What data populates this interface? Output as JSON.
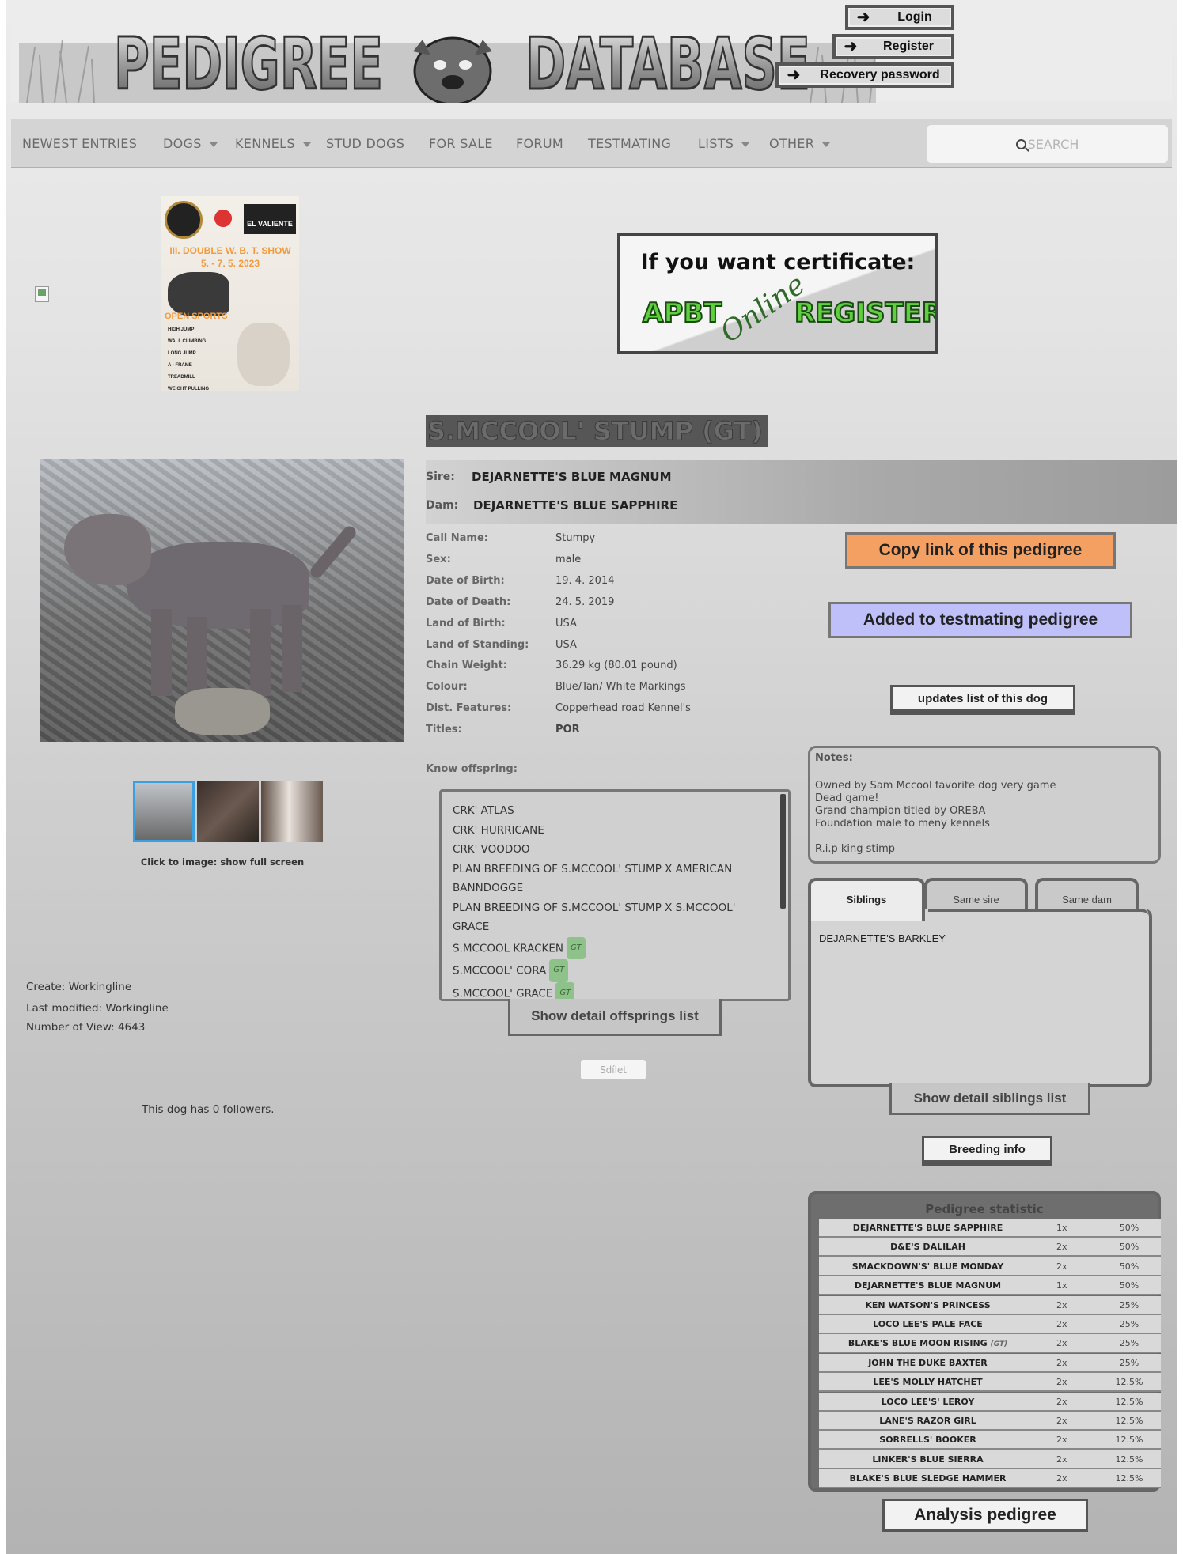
{
  "header": {
    "logo_text": "PEDIGREE DATABASE",
    "auth": {
      "login": "Login",
      "register": "Register",
      "recovery": "Recovery password"
    }
  },
  "nav": {
    "items": [
      {
        "label": "NEWEST ENTRIES",
        "dropdown": false
      },
      {
        "label": "DOGS",
        "dropdown": true
      },
      {
        "label": "KENNELS",
        "dropdown": true
      },
      {
        "label": "STUD DOGS",
        "dropdown": false
      },
      {
        "label": "FOR SALE",
        "dropdown": false
      },
      {
        "label": "FORUM",
        "dropdown": false
      },
      {
        "label": "TESTMATING",
        "dropdown": false
      },
      {
        "label": "LISTS",
        "dropdown": true
      },
      {
        "label": "OTHER",
        "dropdown": true
      }
    ],
    "search_placeholder": "SEARCH"
  },
  "ads": {
    "poster": {
      "title": "III. DOUBLE W. B. T. SHOW",
      "dates": "5. - 7. 5. 2023",
      "brand": "EL VALIENTE",
      "section": "OPEN SPORTS",
      "sports": [
        "HIGH JUMP",
        "WALL CLIMBING",
        "LONG JUMP",
        "A - FRAME",
        "TREADMILL",
        "WEIGHT PULLING"
      ]
    },
    "banner": {
      "line1": "If you want certificate:",
      "left": "APBT",
      "script": "Online",
      "right": "REGISTER"
    }
  },
  "dog": {
    "name": "S.MCCOOL' STUMP (GT)",
    "sire_label": "Sire:",
    "sire": "DEJARNETTE'S BLUE MAGNUM",
    "dam_label": "Dam:",
    "dam": "DEJARNETTE'S BLUE SAPPHIRE",
    "fields": [
      {
        "k": "Call Name:",
        "v": "Stumpy"
      },
      {
        "k": "Sex:",
        "v": "male"
      },
      {
        "k": "Date of Birth:",
        "v": "19. 4. 2014"
      },
      {
        "k": "Date of Death:",
        "v": "24. 5. 2019"
      },
      {
        "k": "Land of Birth:",
        "v": "USA"
      },
      {
        "k": "Land of Standing:",
        "v": "USA"
      },
      {
        "k": "Chain Weight:",
        "v": "36.29 kg (80.01 pound)"
      },
      {
        "k": "Colour:",
        "v": "Blue/Tan/ White Markings"
      },
      {
        "k": "Dist. Features:",
        "v": "Copperhead road Kennel's"
      },
      {
        "k": "Titles:",
        "v": "POR"
      }
    ]
  },
  "gallery": {
    "caption": "Click to image: show full screen"
  },
  "meta": {
    "created": "Create: Workingline",
    "modified": "Last modified: Workingline",
    "views": "Number of View: 4643",
    "followers": "This dog has 0 followers."
  },
  "offspring": {
    "title": "Know offspring:",
    "items": [
      {
        "name": "CRK' ATLAS",
        "gt": false
      },
      {
        "name": "CRK' HURRICANE",
        "gt": false
      },
      {
        "name": "CRK' VOODOO",
        "gt": false
      },
      {
        "name": "PLAN BREEDING OF S.MCCOOL' STUMP X AMERICAN BANNDOGGE",
        "gt": false
      },
      {
        "name": "PLAN BREEDING OF S.MCCOOL' STUMP X S.MCCOOL' GRACE",
        "gt": false
      },
      {
        "name": "S.MCCOOL KRACKEN",
        "gt": true
      },
      {
        "name": "S.MCCOOL' CORA",
        "gt": true
      },
      {
        "name": "S.MCCOOL' GRACE",
        "gt": true
      }
    ],
    "gt_label": "GT",
    "detail_button": "Show detail offsprings list",
    "share_button": "Sdílet"
  },
  "actions": {
    "copy": "Copy link of this pedigree",
    "testmating": "Added to testmating pedigree",
    "updates": "updates list of this dog"
  },
  "notes": {
    "title": "Notes:",
    "lines": [
      "Owned by Sam Mccool favorite dog very game",
      "Dead game!",
      "Grand champion titled by OREBA",
      "Foundation male to meny kennels",
      "",
      "R.i.p king stimp"
    ]
  },
  "siblings": {
    "tabs": [
      "Siblings",
      "Same sire",
      "Same dam"
    ],
    "items": [
      "DEJARNETTE'S BARKLEY"
    ],
    "detail_button": "Show detail siblings list",
    "breeding_info": "Breeding info"
  },
  "stats": {
    "title": "Pedigree statistic",
    "rows": [
      {
        "name": "DEJARNETTE'S BLUE SAPPHIRE",
        "gt": false,
        "count": "1x",
        "pct": "50%"
      },
      {
        "name": "D&E'S DALILAH",
        "gt": false,
        "count": "2x",
        "pct": "50%"
      },
      {
        "name": "SMACKDOWN'S' BLUE MONDAY",
        "gt": false,
        "count": "2x",
        "pct": "50%"
      },
      {
        "name": "DEJARNETTE'S BLUE MAGNUM",
        "gt": false,
        "count": "1x",
        "pct": "50%"
      },
      {
        "name": "KEN WATSON'S PRINCESS",
        "gt": false,
        "count": "2x",
        "pct": "25%"
      },
      {
        "name": "LOCO LEE'S PALE FACE",
        "gt": false,
        "count": "2x",
        "pct": "25%"
      },
      {
        "name": "BLAKE'S BLUE MOON RISING",
        "gt": true,
        "count": "2x",
        "pct": "25%"
      },
      {
        "name": "JOHN THE DUKE BAXTER",
        "gt": false,
        "count": "2x",
        "pct": "25%"
      },
      {
        "name": "LEE'S MOLLY HATCHET",
        "gt": false,
        "count": "2x",
        "pct": "12.5%"
      },
      {
        "name": "LOCO LEE'S' LEROY",
        "gt": false,
        "count": "2x",
        "pct": "12.5%"
      },
      {
        "name": "LANE'S RAZOR GIRL",
        "gt": false,
        "count": "2x",
        "pct": "12.5%"
      },
      {
        "name": "SORRELLS' BOOKER",
        "gt": false,
        "count": "2x",
        "pct": "12.5%"
      },
      {
        "name": "LINKER'S BLUE SIERRA",
        "gt": false,
        "count": "2x",
        "pct": "12.5%"
      },
      {
        "name": "BLAKE'S BLUE SLEDGE HAMMER",
        "gt": false,
        "count": "2x",
        "pct": "12.5%"
      }
    ],
    "gt_label": "(GT)",
    "analysis_button": "Analysis pedigree"
  }
}
